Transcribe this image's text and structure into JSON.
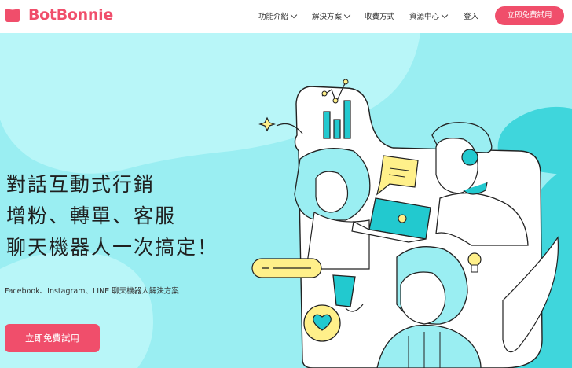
{
  "brand": {
    "name": "BotBonnie",
    "color": "#f04e6b"
  },
  "nav": {
    "items": [
      {
        "label": "功能介紹",
        "dropdown": true
      },
      {
        "label": "解決方案",
        "dropdown": true
      },
      {
        "label": "收費方式",
        "dropdown": false
      },
      {
        "label": "資源中心",
        "dropdown": true
      },
      {
        "label": "登入",
        "dropdown": false
      }
    ],
    "cta": "立即免費試用"
  },
  "hero": {
    "headline": [
      "對話互動式行銷",
      "增粉、轉單、客服",
      "聊天機器人一次搞定！"
    ],
    "subtitle": "Facebook、Instagram、LINE 聊天機器人解決方案",
    "cta": "立即免費試用"
  },
  "colors": {
    "accent": "#f04e6b",
    "hero_bg": "#9aeef2",
    "teal": "#22c9cf",
    "yellow": "#fff08a"
  },
  "icons": [
    "chevron-down-icon",
    "sparkle-icon",
    "bar-chart-icon",
    "message-icon",
    "heart-icon",
    "lightbulb-icon",
    "laptop-icon",
    "headset-icon",
    "cup-icon"
  ]
}
